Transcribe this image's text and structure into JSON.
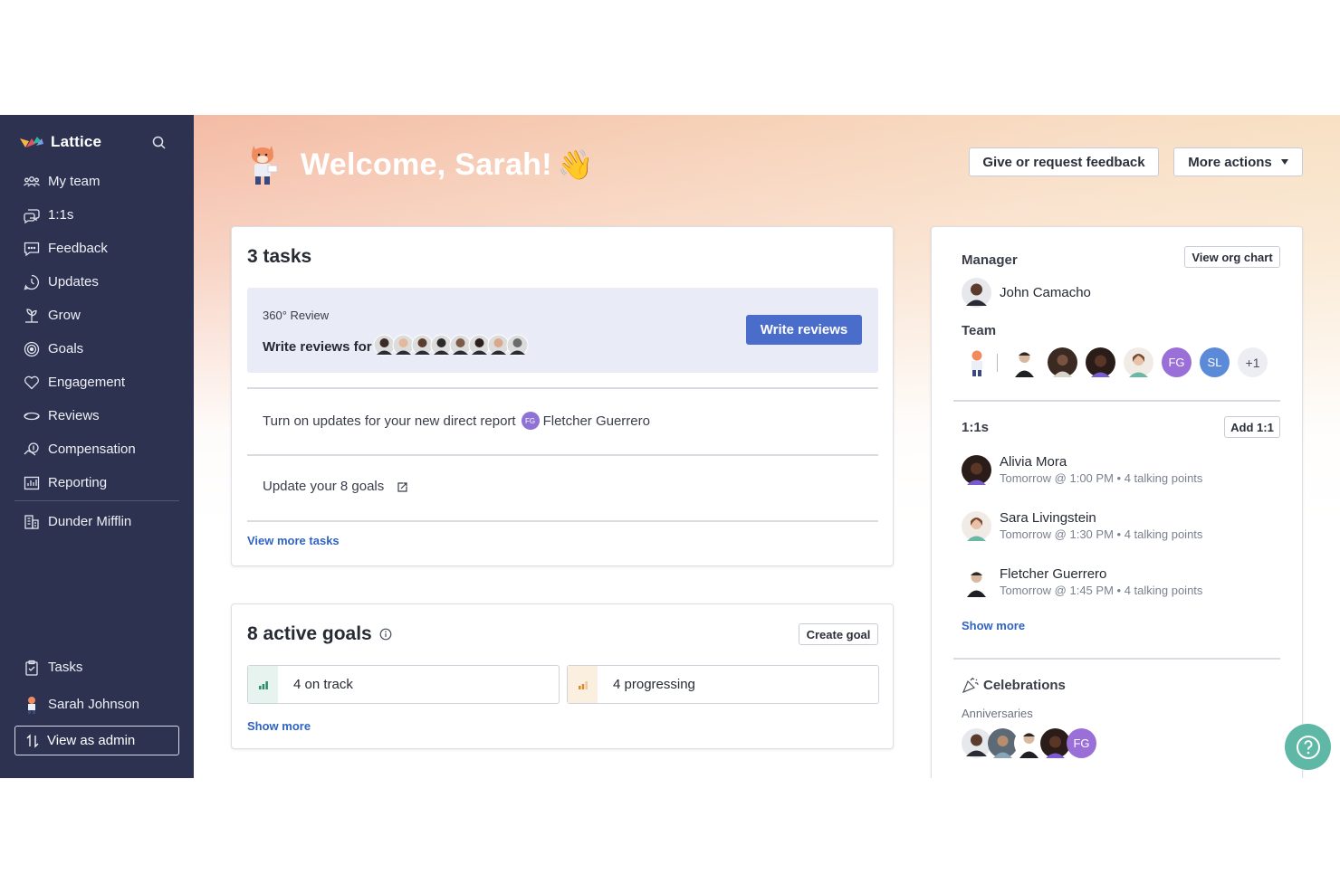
{
  "sidebar": {
    "brand": "Lattice",
    "items": [
      {
        "label": "My team",
        "icon": "team-icon"
      },
      {
        "label": "1:1s",
        "icon": "chat-bubbles-icon"
      },
      {
        "label": "Feedback",
        "icon": "feedback-icon"
      },
      {
        "label": "Updates",
        "icon": "updates-icon"
      },
      {
        "label": "Grow",
        "icon": "grow-icon"
      },
      {
        "label": "Goals",
        "icon": "target-icon"
      },
      {
        "label": "Engagement",
        "icon": "heart-icon"
      },
      {
        "label": "Reviews",
        "icon": "reviews-icon"
      },
      {
        "label": "Compensation",
        "icon": "compensation-icon"
      },
      {
        "label": "Reporting",
        "icon": "reporting-icon"
      }
    ],
    "org": {
      "label": "Dunder Mifflin",
      "icon": "building-icon"
    },
    "tasks_label": "Tasks",
    "user_name": "Sarah Johnson",
    "admin_label": "View as admin"
  },
  "header": {
    "welcome": "Welcome, Sarah!",
    "wave": "👋",
    "feedback_button": "Give or request feedback",
    "more_actions_button": "More actions"
  },
  "tasks": {
    "title": "3 tasks",
    "review": {
      "label": "360° Review",
      "text": "Write reviews for",
      "button": "Write reviews",
      "avatar_colors": [
        "#3b2a25",
        "#e4b89c",
        "#5a3d2e",
        "#2a2a2a",
        "#7a5a48",
        "#2c1f1c",
        "#d8a98a",
        "#6b6b6b"
      ]
    },
    "updates_text": "Turn on updates for your new direct report",
    "updates_initials": "FG",
    "updates_person": "Fletcher Guerrero",
    "goals_text": "Update your 8 goals",
    "view_more": "View more tasks"
  },
  "goals": {
    "title": "8 active goals",
    "create_button": "Create goal",
    "on_track": "4 on track",
    "progressing": "4 progressing",
    "show_more": "Show more",
    "colors": {
      "on_track": "#2f8a6e",
      "progressing": "#d98a2b"
    }
  },
  "right": {
    "manager_label": "Manager",
    "org_chart_button": "View org chart",
    "manager_name": "John Camacho",
    "team_label": "Team",
    "team_initials": [
      {
        "initials": "FG",
        "color": "#9b6fd8"
      },
      {
        "initials": "SL",
        "color": "#5b8ad8"
      }
    ],
    "team_more": "+1",
    "oneonones_label": "1:1s",
    "add_button": "Add 1:1",
    "meetings": [
      {
        "name": "Alivia Mora",
        "time": "Tomorrow @ 1:00 PM",
        "points": "4 talking points"
      },
      {
        "name": "Sara Livingstein",
        "time": "Tomorrow @ 1:30 PM",
        "points": "4 talking points"
      },
      {
        "name": "Fletcher Guerrero",
        "time": "Tomorrow @ 1:45 PM",
        "points": "4 talking points"
      }
    ],
    "show_more": "Show more",
    "celebrations_label": "Celebrations",
    "anniversaries_label": "Anniversaries",
    "anniv_initials": "FG"
  },
  "colors": {
    "sidebar": "#2d3250",
    "primary": "#4a6ccb",
    "link": "#2f63c4",
    "help": "#5eb8a5"
  }
}
